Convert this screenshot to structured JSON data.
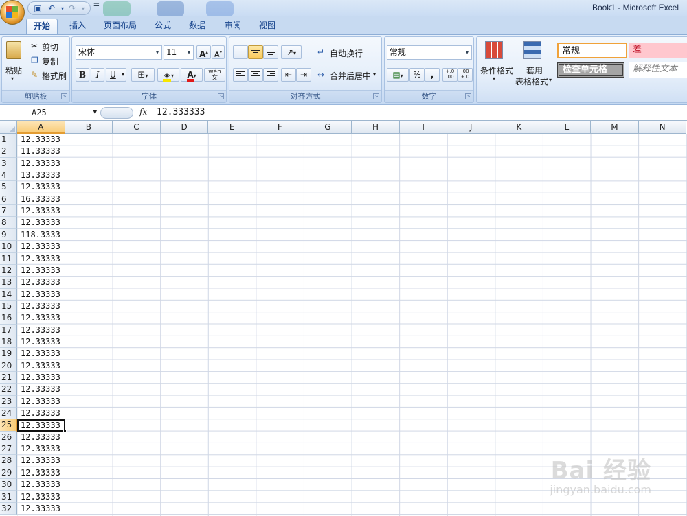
{
  "window": {
    "title": "Book1 - Microsoft Excel"
  },
  "quick_access": {
    "icons": [
      "office-logo-icon",
      "save-icon",
      "undo-icon",
      "redo-icon",
      "customize-icon"
    ]
  },
  "tabs": [
    "开始",
    "插入",
    "页面布局",
    "公式",
    "数据",
    "审阅",
    "视图"
  ],
  "active_tab": "开始",
  "ribbon": {
    "clipboard": {
      "paste": "粘贴",
      "cut": "剪切",
      "copy": "复制",
      "format_painter": "格式刷",
      "label": "剪贴板"
    },
    "font": {
      "name": "宋体",
      "size": "11",
      "bold": "B",
      "italic": "I",
      "underline": "U",
      "font_color": "A",
      "grow": "A",
      "shrink": "A",
      "phonetic": "wén",
      "label": "字体"
    },
    "alignment": {
      "wrap_text": "自动换行",
      "merge_center": "合并后居中",
      "label": "对齐方式"
    },
    "number": {
      "format": "常规",
      "percent": "%",
      "comma": ",",
      "inc_decimal": "+.0 .00",
      "dec_decimal": ".00 +.0",
      "label": "数字"
    },
    "styles": {
      "conditional": "条件格式",
      "table_format_1": "套用",
      "table_format_2": "表格格式",
      "normal": "常规",
      "bad": "差",
      "check_cell": "检查单元格",
      "explanatory": "解释性文本"
    }
  },
  "formula_bar": {
    "name_box": "A25",
    "fx": "fx",
    "value": "12.333333"
  },
  "sheet": {
    "columns": [
      "A",
      "B",
      "C",
      "D",
      "E",
      "F",
      "G",
      "H",
      "I",
      "J",
      "K",
      "L",
      "M",
      "N"
    ],
    "rows": [
      1,
      2,
      3,
      4,
      5,
      6,
      7,
      8,
      9,
      10,
      11,
      12,
      13,
      14,
      15,
      16,
      17,
      18,
      19,
      20,
      21,
      22,
      23,
      24,
      25,
      26,
      27,
      28,
      29,
      30,
      31,
      32
    ],
    "selected_cell": "A25",
    "column_a": [
      "12.33333",
      "11.33333",
      "12.33333",
      "13.33333",
      "12.33333",
      "16.33333",
      "12.33333",
      "12.33333",
      "118.3333",
      "12.33333",
      "12.33333",
      "12.33333",
      "12.33333",
      "12.33333",
      "12.33333",
      "12.33333",
      "12.33333",
      "12.33333",
      "12.33333",
      "12.33333",
      "12.33333",
      "12.33333",
      "12.33333",
      "12.33333",
      "12.33333",
      "12.33333",
      "12.33333",
      "12.33333",
      "12.33333",
      "12.33333",
      "12.33333",
      "12.33333"
    ]
  },
  "watermark": {
    "main": "Bai 经验",
    "sub": "jingyan.baidu.com"
  }
}
